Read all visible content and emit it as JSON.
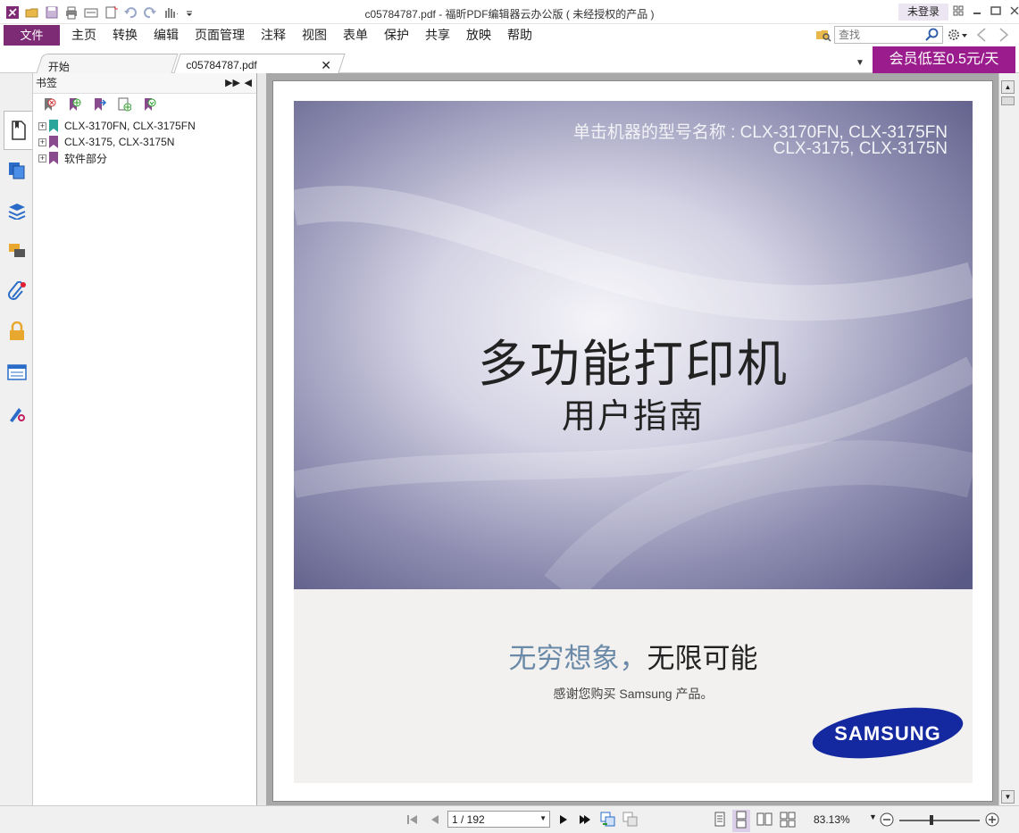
{
  "window": {
    "title": "c05784787.pdf - 福昕PDF编辑器云办公版 ( 未经授权的产品 )",
    "login_label": "未登录"
  },
  "menubar": {
    "file_label": "文件",
    "items": [
      "主页",
      "转换",
      "编辑",
      "页面管理",
      "注释",
      "视图",
      "表单",
      "保护",
      "共享",
      "放映",
      "帮助"
    ],
    "search_placeholder": "查找"
  },
  "tabs": {
    "start_label": "开始",
    "doc_label": "c05784787.pdf",
    "vip_banner": "会员低至0.5元/天"
  },
  "bookmarks": {
    "header": "书签",
    "items": [
      {
        "label": "CLX-3170FN, CLX-3175FN",
        "flag_color": "#2aa59b"
      },
      {
        "label": "CLX-3175, CLX-3175N",
        "flag_color": "#8a4a8e"
      },
      {
        "label": "软件部分",
        "flag_color": "#8a4a8e"
      }
    ]
  },
  "document": {
    "model_line1": "单击机器的型号名称 : CLX-3170FN, CLX-3175FN",
    "model_line2": "CLX-3175, CLX-3175N",
    "title": "多功能打印机",
    "subtitle": "用户指南",
    "slogan_part1": "无穷想象，",
    "slogan_part2": "无限可能",
    "thanks": "感谢您购买 Samsung 产品。",
    "logo_text": "SAMSUNG",
    "logo_color": "#1428a0"
  },
  "statusbar": {
    "page_display": "1 / 192",
    "zoom": "83.13%"
  },
  "colors": {
    "accent": "#7d2b74",
    "vip": "#9b1d8d"
  }
}
